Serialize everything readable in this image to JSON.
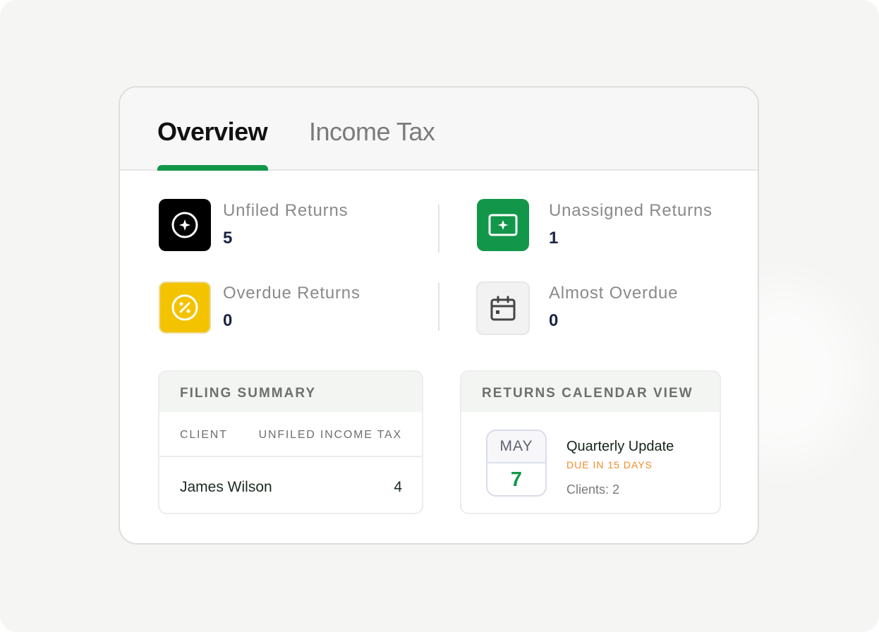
{
  "tabs": [
    {
      "label": "Overview",
      "active": true
    },
    {
      "label": "Income Tax",
      "active": false
    }
  ],
  "stats": {
    "unfiled": {
      "label": "Unfiled Returns",
      "value": "5",
      "icon": "sparkle-circle-icon",
      "color": "#000000"
    },
    "unassigned": {
      "label": "Unassigned Returns",
      "value": "1",
      "icon": "sparkle-screen-icon",
      "color": "#12974a"
    },
    "overdue": {
      "label": "Overdue Returns",
      "value": "0",
      "icon": "percent-circle-icon",
      "color": "#f3c300"
    },
    "almost_overdue": {
      "label": "Almost Overdue",
      "value": "0",
      "icon": "calendar-icon",
      "color": "#f2f2f2"
    }
  },
  "filing_summary": {
    "title": "FILING SUMMARY",
    "columns": [
      "CLIENT",
      "UNFILED INCOME TAX"
    ],
    "rows": [
      {
        "client": "James Wilson",
        "unfiled_income_tax": "4"
      }
    ]
  },
  "calendar_view": {
    "title": "RETURNS CALENDAR VIEW",
    "month": "MAY",
    "day": "7",
    "event_title": "Quarterly Update",
    "event_due": "DUE IN 15 DAYS",
    "event_clients": "Clients: 2"
  },
  "colors": {
    "accent": "#12974a",
    "warning": "#f08c28",
    "value_text": "#1b2545"
  }
}
